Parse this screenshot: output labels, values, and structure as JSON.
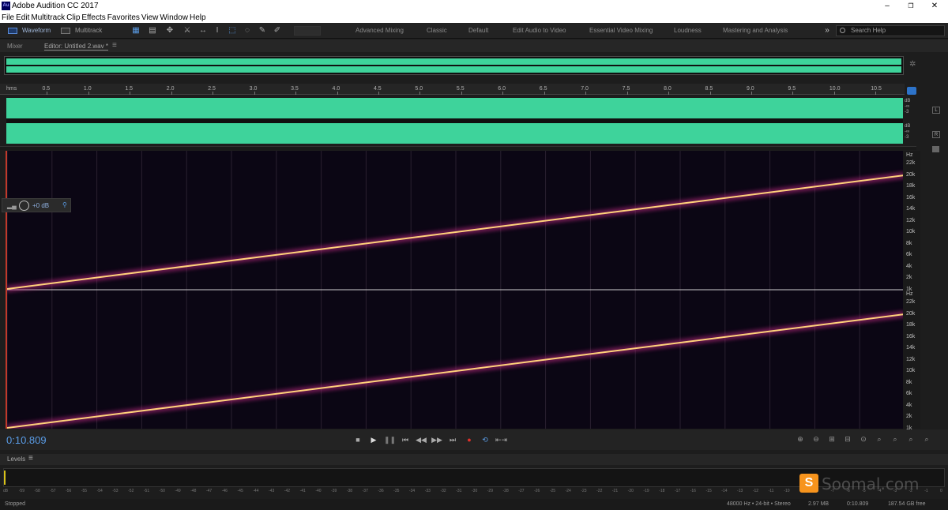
{
  "window": {
    "title": "Adobe Audition CC 2017",
    "app_icon_text": "Au"
  },
  "menu": [
    "File",
    "Edit",
    "Multitrack",
    "Clip",
    "Effects",
    "Favorites",
    "View",
    "Window",
    "Help"
  ],
  "toolbar": {
    "waveform_label": "Waveform",
    "multitrack_label": "Multitrack",
    "workspaces": [
      "Advanced Mixing",
      "Classic",
      "Default",
      "Edit Audio to Video",
      "Essential Video Mixing",
      "Loudness",
      "Mastering and Analysis"
    ],
    "search_placeholder": "Search Help"
  },
  "panels": {
    "mixer_tab": "Mixer",
    "editor_tab": "Editor: Untitled 2.wav *"
  },
  "ruler": {
    "unit_label": "hms",
    "ticks": [
      "0.5",
      "1.0",
      "1.5",
      "2.0",
      "2.5",
      "3.0",
      "3.5",
      "4.0",
      "4.5",
      "5.0",
      "5.5",
      "6.0",
      "6.5",
      "7.0",
      "7.5",
      "8.0",
      "8.5",
      "9.0",
      "9.5",
      "10.0",
      "10.5"
    ]
  },
  "waveform_scale": {
    "db_label": "dB",
    "neg_inf": "-∞",
    "minus3": "-3",
    "left_channel": "L",
    "right_channel": "R"
  },
  "spectral_scale": {
    "unit": "Hz",
    "labels": [
      "22k",
      "20k",
      "18k",
      "16k",
      "14k",
      "12k",
      "10k",
      "8k",
      "6k",
      "4k",
      "2k",
      "1k"
    ]
  },
  "gain_hud": {
    "value": "+0 dB"
  },
  "transport": {
    "timecode": "0:10.809"
  },
  "levels": {
    "label": "Levels",
    "scale": [
      "dB",
      "-59",
      "-58",
      "-57",
      "-56",
      "-55",
      "-54",
      "-53",
      "-52",
      "-51",
      "-50",
      "-49",
      "-48",
      "-47",
      "-46",
      "-45",
      "-44",
      "-43",
      "-42",
      "-41",
      "-40",
      "-39",
      "-38",
      "-37",
      "-36",
      "-35",
      "-34",
      "-33",
      "-32",
      "-31",
      "-30",
      "-29",
      "-28",
      "-27",
      "-26",
      "-25",
      "-24",
      "-23",
      "-22",
      "-21",
      "-20",
      "-19",
      "-18",
      "-17",
      "-16",
      "-15",
      "-14",
      "-13",
      "-12",
      "-11",
      "-10",
      "-9",
      "-8",
      "-7",
      "-6",
      "-5",
      "-4",
      "-3",
      "-2",
      "-1",
      "0"
    ]
  },
  "status": {
    "state": "Stopped",
    "format": "48000 Hz • 24-bit • Stereo",
    "size": "2.97 MB",
    "duration": "0:10.809",
    "free": "187.54 GB free"
  },
  "watermark": {
    "text": "Soomal.com",
    "logo_letter": "S"
  },
  "colors": {
    "waveform": "#3ed39b",
    "sweep": "#ffd27a",
    "accent": "#5a9ce6",
    "spectro_bg": "#0b0614"
  }
}
